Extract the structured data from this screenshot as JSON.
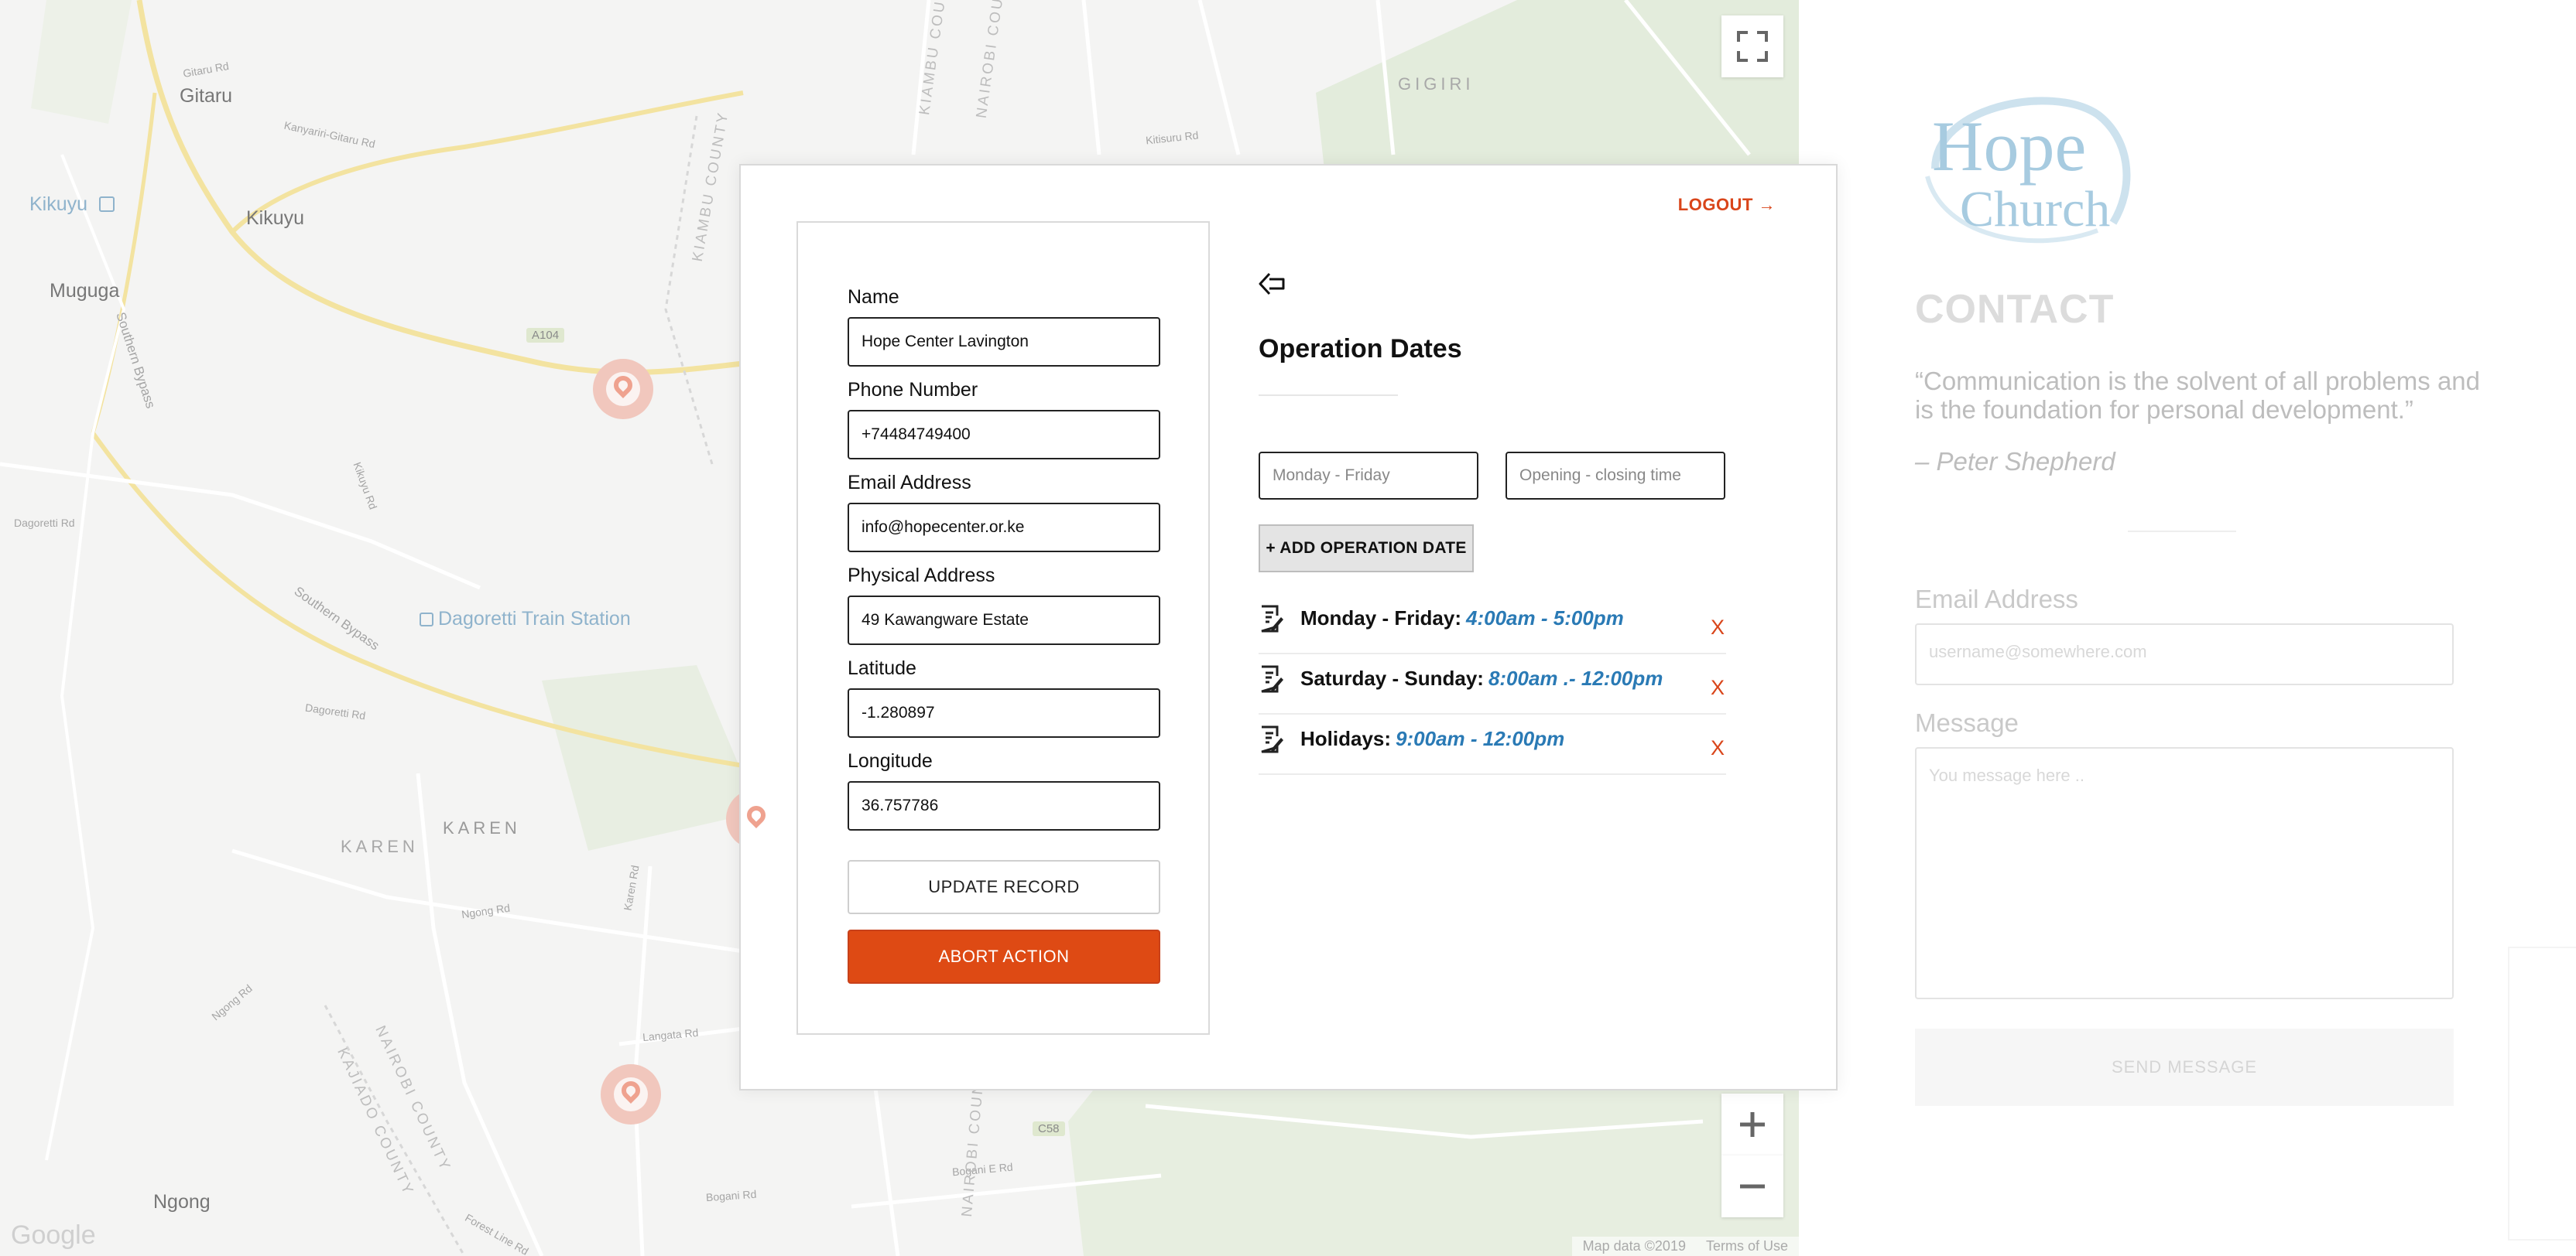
{
  "map": {
    "labels": {
      "gitaru": "Gitaru",
      "gitaru_rd": "Gitaru Rd",
      "kikuyu_poi": "Kikuyu",
      "kikuyu_town": "Kikuyu",
      "muguga": "Muguga",
      "southern_bypass_1": "Southern Bypass",
      "southern_bypass_2": "Southern Bypass",
      "dagoretti_station": "Dagoretti Train Station",
      "karen_area": "KAREN",
      "karen_label": "KAREN",
      "ngong": "Ngong",
      "gigiri": "GIGIRI",
      "kiambu_county": "KIAMBU COUNTY",
      "nairobi_county": "NAIROBI COUNTY",
      "nairobi_county_2": "NAIROBI COUNTY",
      "kajiado_county": "KAJIADO COUNTY",
      "kiambu_county_top": "KIAMBU COUNTY",
      "nairobi_county_top": "NAIROBI COUNTY",
      "kanyariri_rd": "Kanyariri-Gitaru Rd",
      "kikuyu_rd": "Kikuyu Rd",
      "dagoretti_rd": "Dagoretti Rd",
      "dagoretti_rd_2": "Dagoretti Rd",
      "ngong_rd": "Ngong Rd",
      "ngong_rd_2": "Ngong Rd",
      "langata_rd": "Langata Rd",
      "karen_rd": "Karen Rd",
      "bogani_rd": "Bogani Rd",
      "bogani_e_rd": "Bogani E Rd",
      "forest_line_rd": "Forest Line Rd",
      "kitisuru_rd": "Kitisuru Rd",
      "a104": "A104",
      "c58": "C58"
    },
    "footer": {
      "map_data": "Map data ©2019",
      "terms": "Terms of Use"
    },
    "google": "Google",
    "icons": {
      "fullscreen": "fullscreen-icon",
      "zoom_in": "plus-icon",
      "zoom_out": "minus-icon",
      "pin": "map-pin-icon"
    }
  },
  "contact": {
    "logo_line1": "Hope",
    "logo_line2": "Church",
    "title": "CONTACT",
    "quote": "“Communication is the solvent of all problems and is the foundation for personal development.”",
    "quote_author": "– Peter Shepherd",
    "email_label": "Email Address",
    "email_placeholder": "username@somewhere.com",
    "message_label": "Message",
    "message_placeholder": "You message here ..",
    "send_label": "SEND MESSAGE"
  },
  "modal": {
    "logout": "LOGOUT →",
    "form": {
      "name_label": "Name",
      "name_value": "Hope Center Lavington",
      "phone_label": "Phone Number",
      "phone_value": "+74484749400",
      "email_label": "Email Address",
      "email_value": "info@hopecenter.or.ke",
      "address_label": "Physical Address",
      "address_value": "49 Kawangware Estate",
      "latitude_label": "Latitude",
      "latitude_value": "-1.280897",
      "longitude_label": "Longitude",
      "longitude_value": "36.757786",
      "update_label": "UPDATE RECORD",
      "abort_label": "ABORT ACTION"
    },
    "operation": {
      "title": "Operation Dates",
      "days_placeholder": "Monday - Friday",
      "times_placeholder": "Opening - closing time",
      "add_label": "+ ADD OPERATION DATE",
      "items": [
        {
          "days": "Monday - Friday:",
          "hours": "4:00am - 5:00pm",
          "remove": "X"
        },
        {
          "days": "Saturday - Sunday:",
          "hours": "8:00am .- 12:00pm",
          "remove": "X"
        },
        {
          "days": "Holidays:",
          "hours": "9:00am - 12:00pm",
          "remove": "X"
        }
      ]
    }
  },
  "colors": {
    "accent": "#de4a14",
    "hours_blue": "#2a7ab5",
    "remove_red": "#d9451a"
  }
}
